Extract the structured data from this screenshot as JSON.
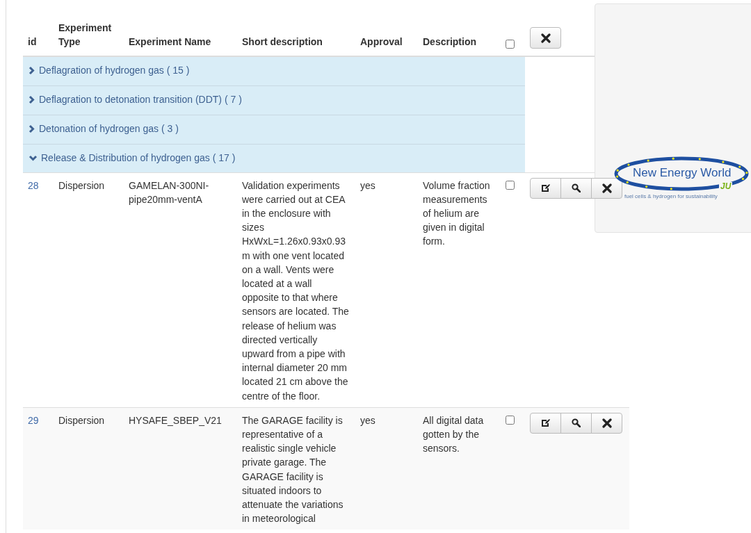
{
  "table": {
    "columns": [
      {
        "label": "id"
      },
      {
        "label": "Experiment Type"
      },
      {
        "label": "Experiment Name"
      },
      {
        "label": "Short description"
      },
      {
        "label": "Approval"
      },
      {
        "label": "Description"
      }
    ],
    "select_all": {
      "checked": false
    },
    "groups": [
      {
        "label": "Deflagration of hydrogen gas ( 15 )",
        "expanded": false
      },
      {
        "label": "Deflagration to detonation transition (DDT) ( 7 )",
        "expanded": false
      },
      {
        "label": "Detonation of hydrogen gas ( 3 )",
        "expanded": false
      },
      {
        "label": "Release & Distribution of hydrogen gas ( 17 )",
        "expanded": true
      }
    ],
    "rows": [
      {
        "id": "28",
        "type": "Dispersion",
        "name": "GAMELAN-300NI-pipe20mm-ventA",
        "short_description": "Validation experiments were carried out at CEA in the enclosure with sizes HxWxL=1.26x0.93x0.93 m with one vent located on a wall. Vents were located at a wall opposite to that where sensors are located. The release of helium was directed vertically upward from a pipe with internal diameter 20 mm located 21 cm above the centre of the floor.",
        "approval": "yes",
        "description": "Volume fraction measurements of helium are given in digital form.",
        "checked": false
      },
      {
        "id": "29",
        "type": "Dispersion",
        "name": "HYSAFE_SBEP_V21",
        "short_description": "The GARAGE facility is representative of a realistic single vehicle private garage. The GARAGE facility is situated indoors to attenuate the variations in meteorological",
        "approval": "yes",
        "description": "All digital data gotten by the sensors.",
        "checked": false
      }
    ]
  },
  "logo": {
    "title": "New Energy World",
    "badge": "JU",
    "tagline": "fuel cells & hydrogen for sustainability"
  }
}
